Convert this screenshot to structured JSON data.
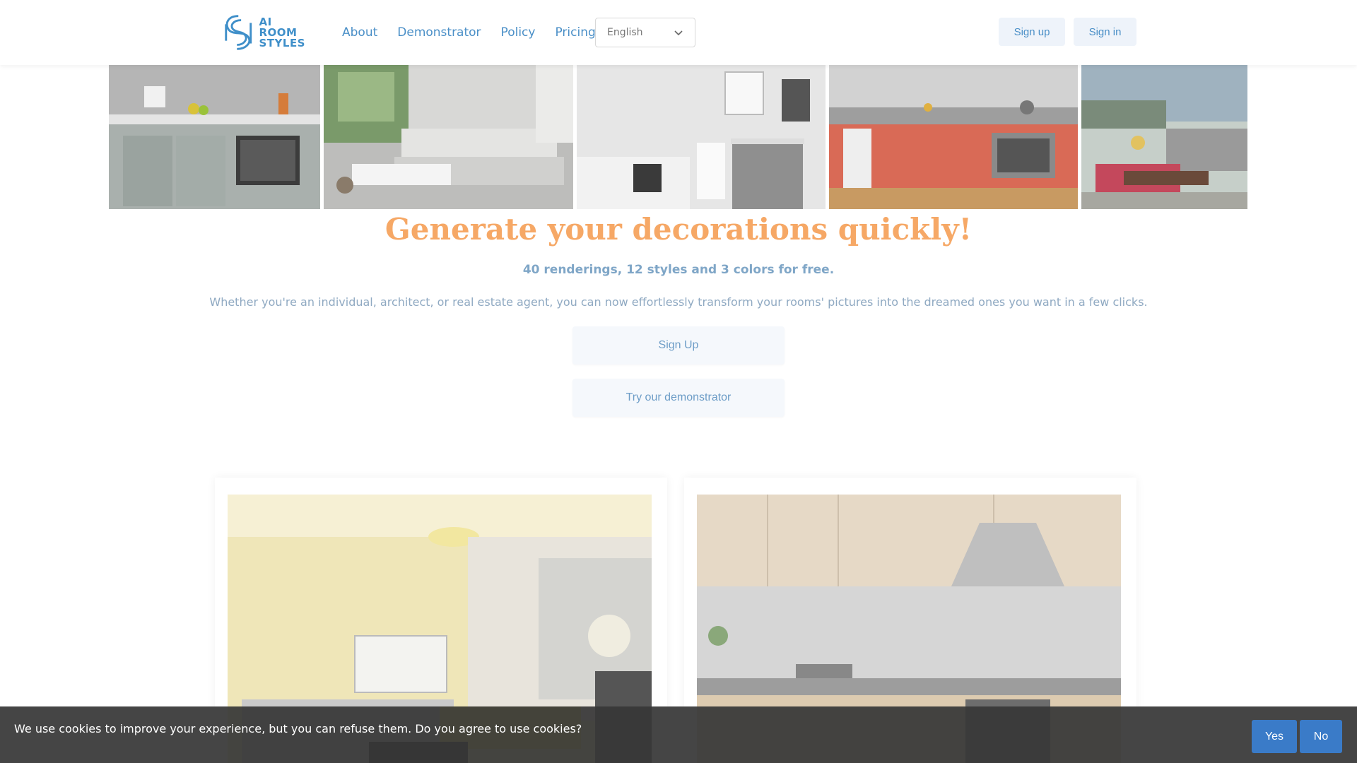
{
  "brand": {
    "logo_line1": "AI",
    "logo_line2": "ROOM",
    "logo_line3": "STYLES",
    "color": "#3f8fc9"
  },
  "nav": {
    "links": [
      "About",
      "Demonstrator",
      "Policy",
      "Pricing"
    ],
    "language": "English",
    "signup_label": "Sign up",
    "signin_label": "Sign in"
  },
  "gallery": {
    "images": [
      "kitchen-gray",
      "living-room-white-sofa",
      "bathroom-white",
      "kitchen-red",
      "living-room-terrace"
    ]
  },
  "hero": {
    "title": "Generate your decorations quickly!",
    "subtitle": "40 renderings, 12 styles and 3 colors for free.",
    "description": "Whether you're an individual, architect, or real estate agent, you can now effortlessly transform your rooms' pictures into the dreamed ones you want in a few clicks.",
    "cta_signup": "Sign Up",
    "cta_demo": "Try our demonstrator",
    "title_color": "#f6a866"
  },
  "cards": [
    {
      "image": "living-room-yellow"
    },
    {
      "image": "kitchen-wood-gray"
    }
  ],
  "cookie": {
    "message": "We use cookies to improve your experience, but you can refuse them. Do you agree to use cookies?",
    "yes_label": "Yes",
    "no_label": "No",
    "button_color": "#3a7bc8"
  }
}
